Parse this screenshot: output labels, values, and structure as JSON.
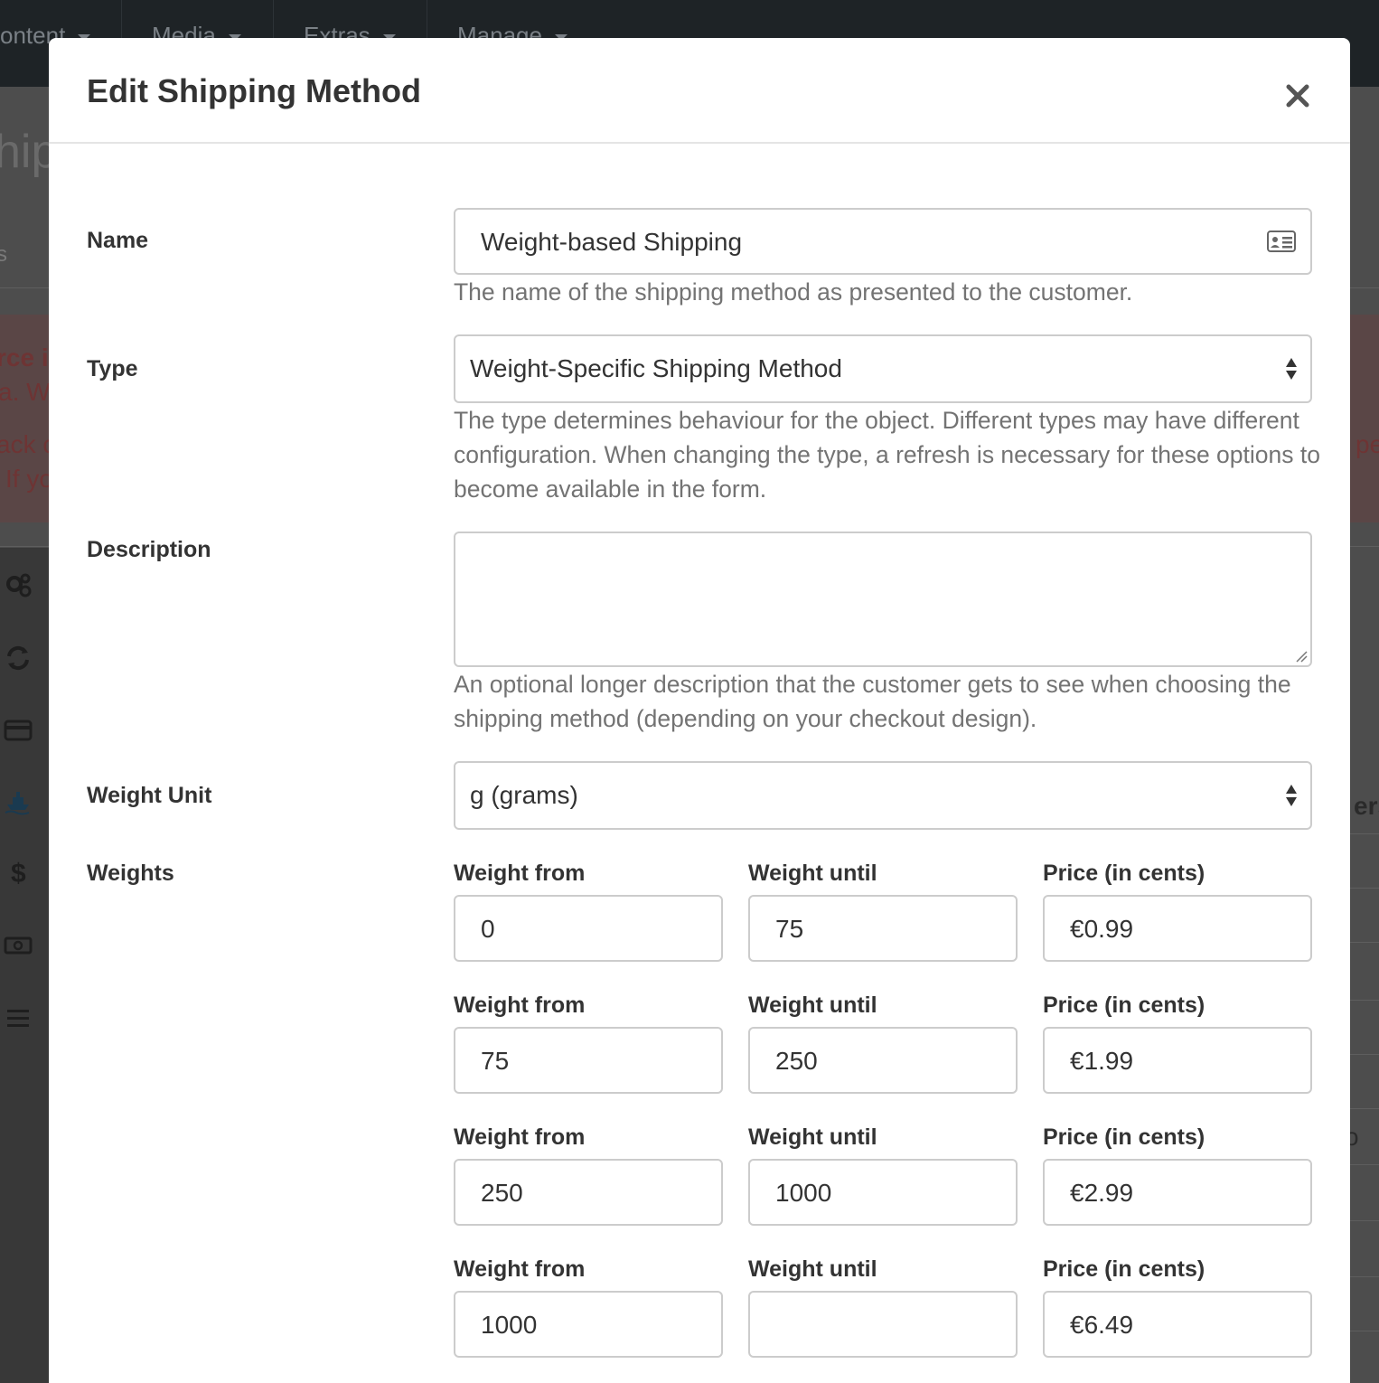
{
  "background": {
    "menu": [
      "ontent",
      "Media",
      "Extras",
      "Manage"
    ],
    "left_fragments": [
      "hip",
      "s",
      "rce i",
      "a. W",
      "ack c",
      "If yo"
    ],
    "right_fragments": [
      "pe",
      "ers",
      "o"
    ]
  },
  "modal": {
    "title": "Edit Shipping Method",
    "close_label": "×"
  },
  "form": {
    "name": {
      "label": "Name",
      "value": "Weight-based Shipping",
      "help": "The name of the shipping method as presented to the customer."
    },
    "type": {
      "label": "Type",
      "value": "Weight-Specific Shipping Method",
      "help": "The type determines behaviour for the object. Different types may have different configuration. When changing the type, a refresh is necessary for these options to become available in the form."
    },
    "description": {
      "label": "Description",
      "value": "",
      "help": "An optional longer description that the customer gets to see when choosing the shipping method (depending on your checkout design)."
    },
    "weight_unit": {
      "label": "Weight Unit",
      "value": "g (grams)"
    },
    "weights": {
      "label": "Weights",
      "col_from": "Weight from",
      "col_until": "Weight until",
      "col_price": "Price (in cents)",
      "rows": [
        {
          "from": "0",
          "until": "75",
          "price": "€0.99"
        },
        {
          "from": "75",
          "until": "250",
          "price": "€1.99"
        },
        {
          "from": "250",
          "until": "1000",
          "price": "€2.99"
        },
        {
          "from": "1000",
          "until": "",
          "price": "€6.49"
        }
      ]
    }
  },
  "colors": {
    "topbar": "#1e2326",
    "overlay": "#4d4d4d",
    "border": "#cccccc",
    "help_text": "#737373"
  }
}
